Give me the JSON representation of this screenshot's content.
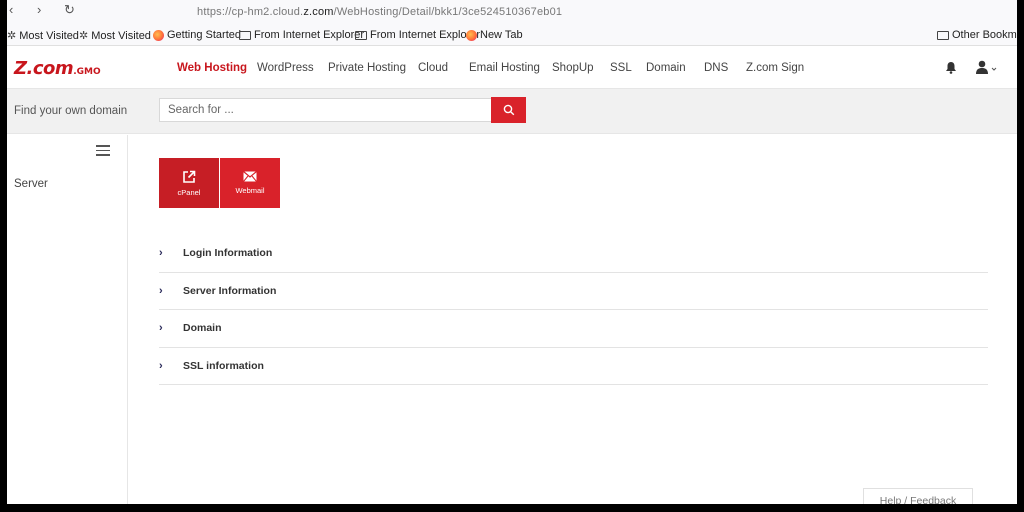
{
  "browser": {
    "url": "https://cp-hm2.cloud.z.com/WebHosting/Detail/bkk1/3ce524510367eb01",
    "url_domain": "z.com",
    "nav_glyphs": [
      "‹",
      "›",
      "↻"
    ]
  },
  "bookmarks": {
    "items": [
      {
        "label": "Most Visited",
        "icon": "gear-icon"
      },
      {
        "label": "Most Visited",
        "icon": "gear-icon"
      },
      {
        "label": "Getting Started",
        "icon": "firefox-icon"
      },
      {
        "label": "From Internet Explorer",
        "icon": "folder-icon"
      },
      {
        "label": "From Internet Explorer",
        "icon": "folder-icon"
      },
      {
        "label": "New Tab",
        "icon": "firefox-icon"
      }
    ],
    "other": "Other Bookmarks"
  },
  "header": {
    "logo": "Z.com",
    "logo_suffix": "by GMO",
    "nav": [
      {
        "label": "Web Hosting",
        "active": true
      },
      {
        "label": "WordPress"
      },
      {
        "label": "Private Hosting"
      },
      {
        "label": "Cloud"
      },
      {
        "label": "Email Hosting"
      },
      {
        "label": "ShopUp"
      },
      {
        "label": "SSL"
      },
      {
        "label": "Domain"
      },
      {
        "label": "DNS"
      },
      {
        "label": "Z.com Sign"
      }
    ]
  },
  "search": {
    "label": "Find your own domain",
    "placeholder": "Search for ..."
  },
  "sidebar": {
    "items": [
      {
        "label": "Server"
      }
    ]
  },
  "quick_actions": [
    {
      "label": "cPanel",
      "icon": "external-link-icon"
    },
    {
      "label": "Webmail",
      "icon": "envelope-icon"
    }
  ],
  "accordion": [
    {
      "label": "Login Information"
    },
    {
      "label": "Server Information"
    },
    {
      "label": "Domain"
    },
    {
      "label": "SSL information"
    }
  ],
  "footer": {
    "help": "Help / Feedback"
  },
  "colors": {
    "brand": "#c8161d",
    "button": "#d9222a"
  }
}
